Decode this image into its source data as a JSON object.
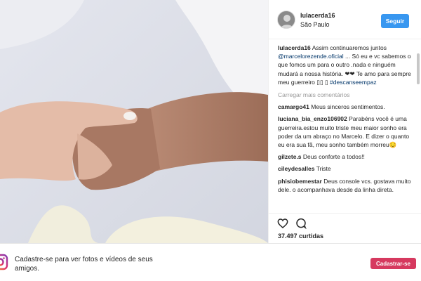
{
  "post": {
    "username": "lulacerda16",
    "location": "São Paulo",
    "follow_label": "Seguir",
    "caption": {
      "username": "lulacerda16",
      "pre": "Assim continuaremos juntos ",
      "mention": "@marcelorezende.oficial",
      "post": " ... Só eu e vc sabemos o que fomos um para o outro .nada e ninguém mudará a nossa história. ❤❤ Te amo para sempre meu guerreiro ▯▯ ▯",
      "hashtag": "#descanseempaz"
    },
    "load_more": "Carregar mais comentários",
    "comments": [
      {
        "user": "camargo41",
        "text": "Meus sinceros sentimentos."
      },
      {
        "user": "luciana_bia_enzo106902",
        "text": "Parabéns você é uma guerreira.estou muito triste meu maior sonho era poder da um abraço no Marcelo. E dizer o quanto eu era sua fã, meu sonho também morreu😔"
      },
      {
        "user": "gilzete.s",
        "text": "Deus conforte a todos!!"
      },
      {
        "user": "cileydesalles",
        "text": "Triste"
      },
      {
        "user": "phisiobemestar",
        "text": "Deus console vcs. gostava muito dele. o acompanhava desde da linha direta."
      }
    ],
    "likes": "37.497 curtidas",
    "icons": {
      "like": "heart-icon",
      "comment": "comment-bubble-icon"
    }
  },
  "footer": {
    "text": "Cadastre-se para ver fotos e vídeos de seus amigos.",
    "signup_label": "Cadastrar-se",
    "icon": "instagram-icon"
  },
  "colors": {
    "follow": "#3897f0",
    "signup": "#d6395f"
  }
}
